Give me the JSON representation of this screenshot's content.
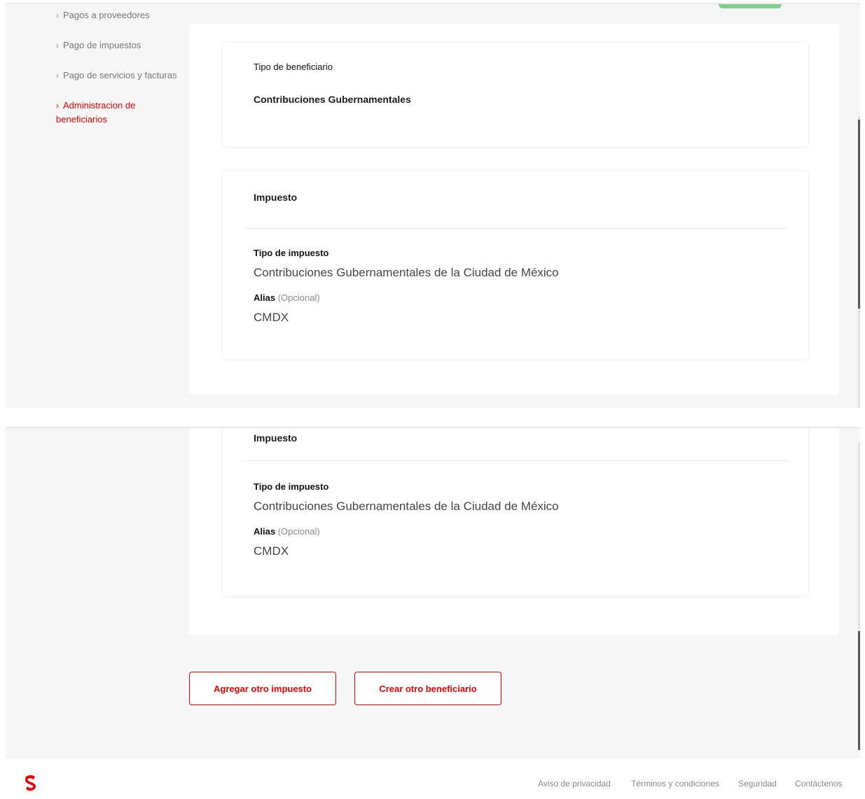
{
  "sidebar": {
    "items": [
      {
        "label": "Pagos a proveedores"
      },
      {
        "label": "Pago de impuestos"
      },
      {
        "label": "Pago de servicios y facturas"
      },
      {
        "label": "Administracion de beneficiarios"
      }
    ]
  },
  "beneficiary": {
    "type_label": "Tipo de beneficiario",
    "type_value": "Contribuciones Gubernamentales"
  },
  "tax": {
    "heading": "Impuesto",
    "type_label": "Tipo de impuesto",
    "type_value": "Contribuciones Gubernamentales de la Ciudad de México",
    "alias_label": "Alias",
    "alias_optional": "(Opcional)",
    "alias_value": "CMDX"
  },
  "actions": {
    "add_tax": "Agregar otro impuesto",
    "create_beneficiary": "Crear otro beneficiario"
  },
  "footer": {
    "links": [
      "Aviso de privacidad",
      "Términos y condiciones",
      "Seguridad",
      "Contáctenos"
    ]
  },
  "colors": {
    "accent": "#ec0000",
    "success": "#7bd08e"
  }
}
